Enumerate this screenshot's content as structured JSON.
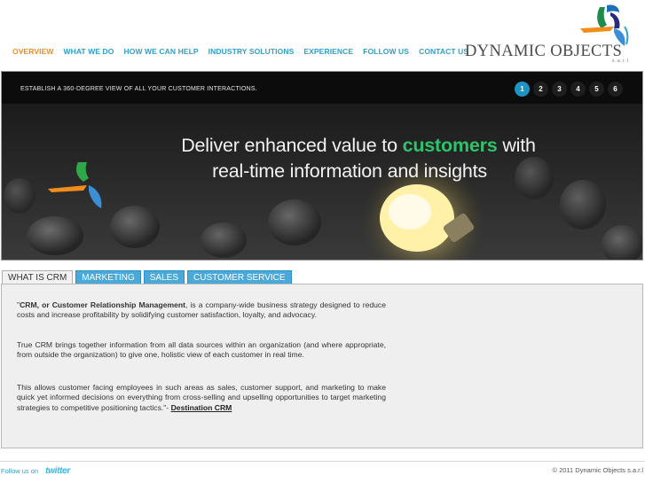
{
  "nav": {
    "items": [
      {
        "label": "OVERVIEW"
      },
      {
        "label": "WHAT WE DO"
      },
      {
        "label": "HOW WE CAN HELP"
      },
      {
        "label": "INDUSTRY SOLUTIONS"
      },
      {
        "label": "EXPERIENCE"
      },
      {
        "label": "FOLLOW US"
      },
      {
        "label": "CONTACT US"
      }
    ],
    "active_color": "#f28c1a",
    "link_color": "#2e9fc9"
  },
  "logo": {
    "text": "DYNAMIC OBJECTS",
    "subtext": "s.a.r.l"
  },
  "banner": {
    "tagline": "ESTABLISH A 360-DEGREE VIEW OF ALL YOUR CUSTOMER INTERACTIONS.",
    "pages": [
      "1",
      "2",
      "3",
      "4",
      "5",
      "6"
    ],
    "active_page": "1",
    "headline_line1_a": "Deliver enhanced value to ",
    "headline_line1_highlight": "customers",
    "headline_line1_b": " with",
    "headline_line2": "real-time information and insights",
    "highlight_color": "#2fc26a"
  },
  "tabs": [
    {
      "label": "WHAT IS CRM"
    },
    {
      "label": "MARKETING"
    },
    {
      "label": "SALES"
    },
    {
      "label": "CUSTOMER SERVICE"
    }
  ],
  "content": {
    "p1_open": "\"",
    "p1_bold": "CRM, or Customer Relationship Management",
    "p1_rest": ", is a company-wide business strategy designed to reduce costs and increase profitability by solidifying customer satisfaction, loyalty, and advocacy.",
    "p2": "True CRM brings together information from all data sources within an organization (and where appropriate, from outside the organization) to give one, holistic view of each customer in real time.",
    "p3": "This allows customer facing employees in such areas as sales, customer support, and marketing to make quick yet informed decisions on everything from cross-selling and upselling opportunities to target marketing strategies to competitive positioning tactics.\"- ",
    "source_link": "Destination CRM"
  },
  "footer": {
    "follow_label": "Follow us on",
    "twitter_label": "twitter",
    "copyright": "© 2011 Dynamic Objects s.a.r.l"
  }
}
